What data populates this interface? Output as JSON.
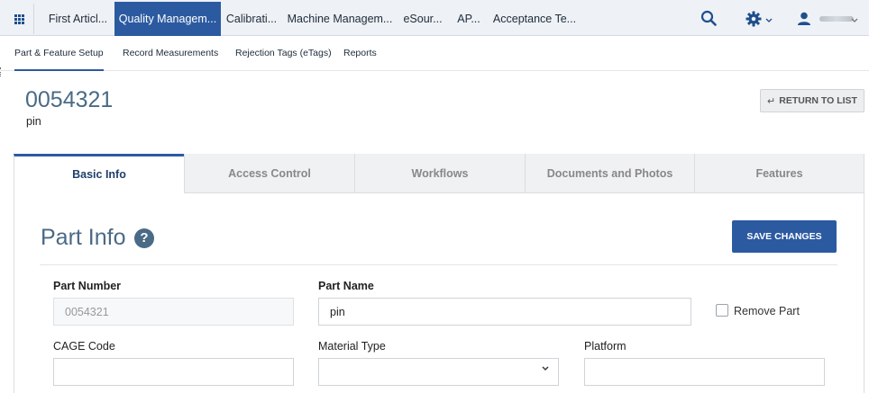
{
  "topnav": {
    "tabs": [
      {
        "label": "First Articl..."
      },
      {
        "label": "Quality Managem...",
        "active": true
      },
      {
        "label": "Calibrati..."
      },
      {
        "label": "Machine Managem..."
      },
      {
        "label": "eSour..."
      },
      {
        "label": "AP..."
      },
      {
        "label": "Acceptance Te..."
      }
    ],
    "icons": {
      "apps": "apps-grid-icon",
      "search": "search-icon",
      "settings": "gear-icon",
      "user": "user-icon"
    }
  },
  "subnav": {
    "tabs": [
      {
        "label": "Part & Feature Setup",
        "active": true
      },
      {
        "label": "Record Measurements"
      },
      {
        "label": "Rejection Tags (eTags)"
      },
      {
        "label": "Reports"
      }
    ]
  },
  "header": {
    "part_number": "0054321",
    "part_name": "pin",
    "return_label": "RETURN TO LIST",
    "return_glyph": "↵"
  },
  "tabs": [
    {
      "label": "Basic Info",
      "active": true
    },
    {
      "label": "Access Control"
    },
    {
      "label": "Workflows"
    },
    {
      "label": "Documents and Photos"
    },
    {
      "label": "Features"
    }
  ],
  "part_info": {
    "title": "Part Info",
    "help_glyph": "?",
    "save_label": "SAVE CHANGES",
    "fields": {
      "part_number": {
        "label": "Part Number",
        "value": "0054321"
      },
      "part_name": {
        "label": "Part Name",
        "value": "pin"
      },
      "remove_part": {
        "label": "Remove Part",
        "checked": false
      },
      "cage_code": {
        "label": "CAGE Code",
        "value": ""
      },
      "material_type": {
        "label": "Material Type",
        "value": ""
      },
      "platform": {
        "label": "Platform",
        "value": ""
      }
    }
  },
  "colors": {
    "accent": "#2c5aa0",
    "heading": "#4a6a86",
    "nav_bg": "#eef1f5"
  }
}
